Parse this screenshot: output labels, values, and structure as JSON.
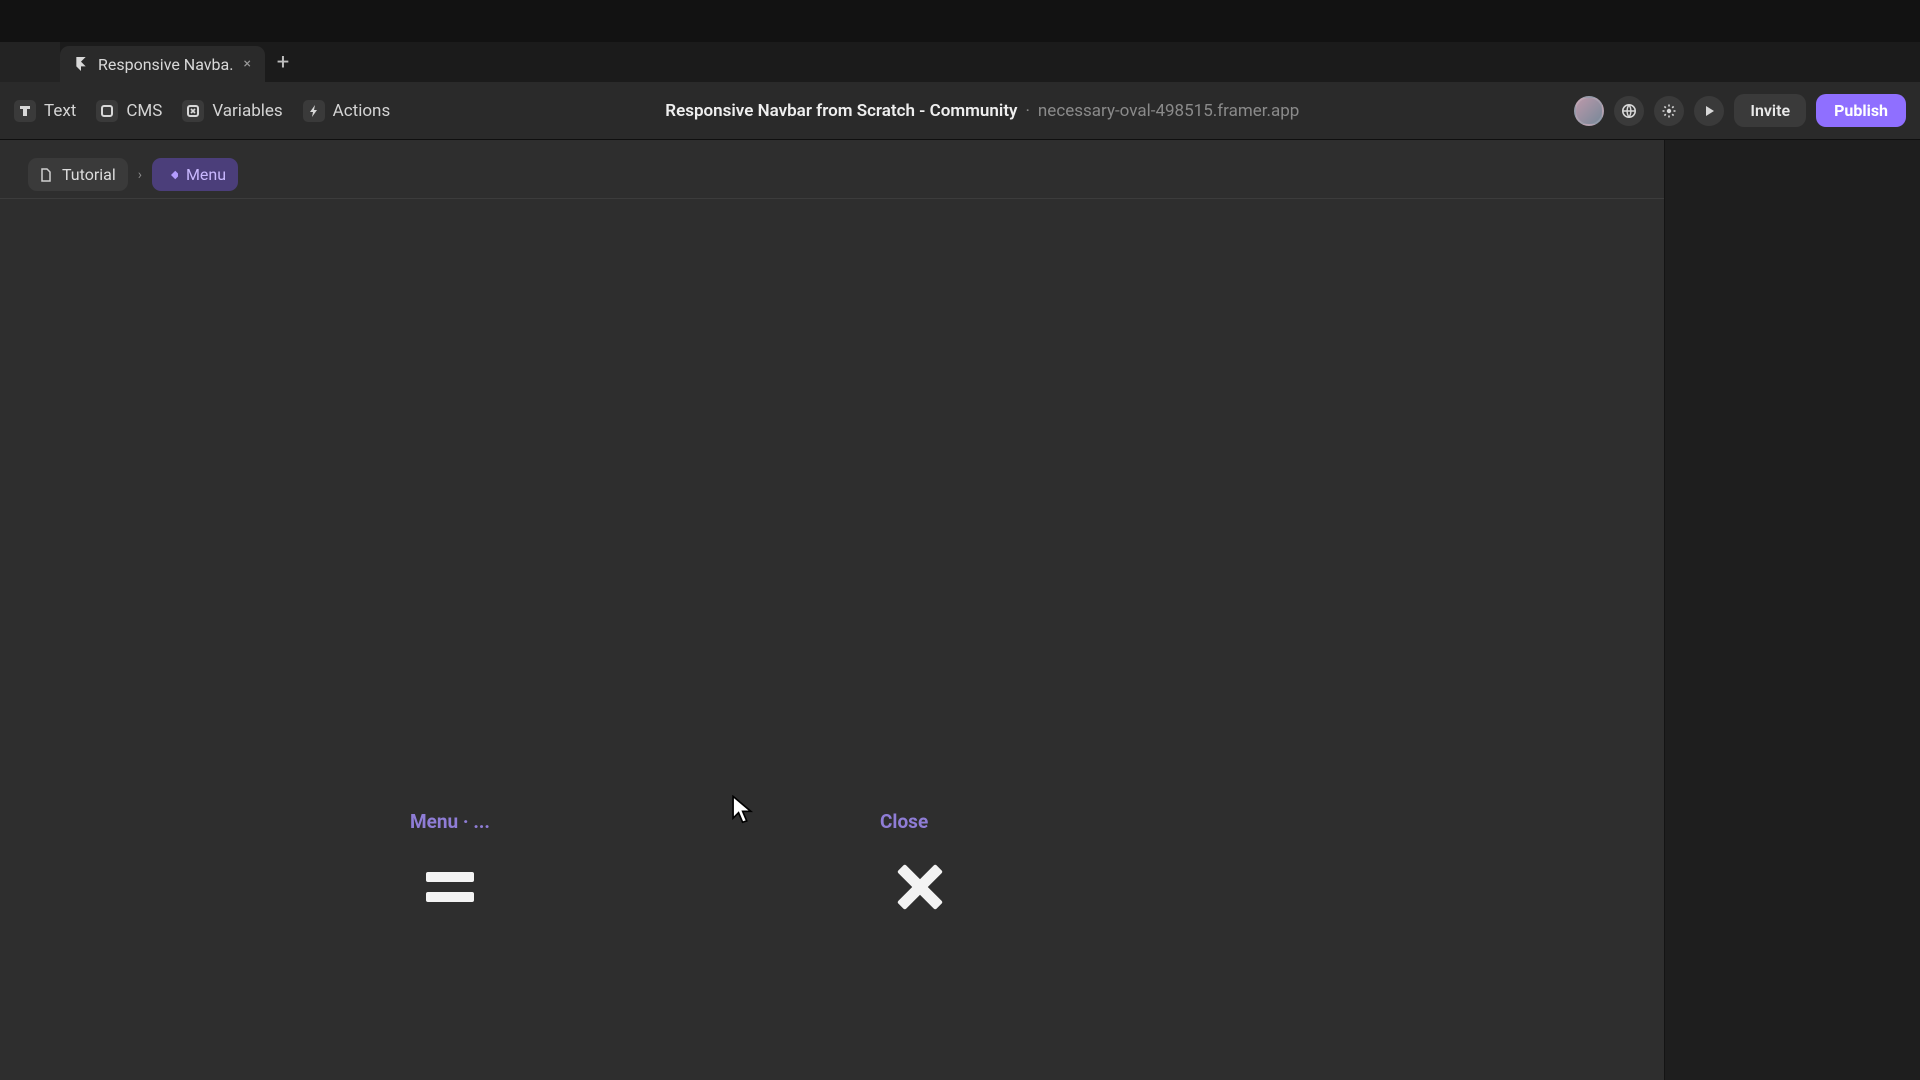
{
  "tab": {
    "title": "Responsive Navba.",
    "close_glyph": "×",
    "add_glyph": "+"
  },
  "toolbar": {
    "items": [
      {
        "label": "Text"
      },
      {
        "label": "CMS"
      },
      {
        "label": "Variables"
      },
      {
        "label": "Actions"
      }
    ],
    "project_title": "Responsive Navbar from Scratch - Community",
    "project_sep": "·",
    "project_domain": "necessary-oval-498515.framer.app",
    "invite_label": "Invite",
    "publish_label": "Publish"
  },
  "crumbs": {
    "page": "Tutorial",
    "component": "Menu",
    "caret": "›"
  },
  "variants": {
    "menu_label": "Menu · ...",
    "close_label": "Close"
  },
  "colors": {
    "accent": "#8f6fff",
    "component_text": "#8f7dd6"
  }
}
